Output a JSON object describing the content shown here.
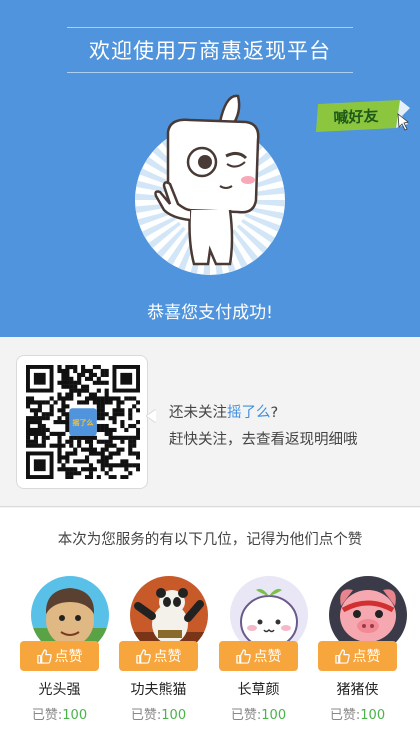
{
  "header": {
    "title": "欢迎使用万商惠返现平台",
    "badge_text": "喊好友",
    "success_message": "恭喜您支付成功!"
  },
  "qr": {
    "logo_text": "摇了么",
    "line1_prefix": "还未关注",
    "line1_link": "摇了么",
    "line1_suffix": "?",
    "line2": "赶快关注，去查看返现明细哦"
  },
  "staff": {
    "intro": "本次为您服务的有以下几位，记得为他们点个赞",
    "like_label": "点赞",
    "liked_prefix": "已赞:",
    "members": [
      {
        "name": "光头强",
        "likes": "100",
        "avatar": "bald-strong-avatar"
      },
      {
        "name": "功夫熊猫",
        "likes": "100",
        "avatar": "kungfu-panda-avatar"
      },
      {
        "name": "长草颜",
        "likes": "100",
        "avatar": "grass-face-avatar"
      },
      {
        "name": "猪猪侠",
        "likes": "100",
        "avatar": "pig-hero-avatar"
      }
    ]
  },
  "colors": {
    "header_bg": "#4f94dc",
    "like_button": "#f7a53d",
    "link": "#3d8fe0",
    "like_count": "#4bb34b"
  }
}
